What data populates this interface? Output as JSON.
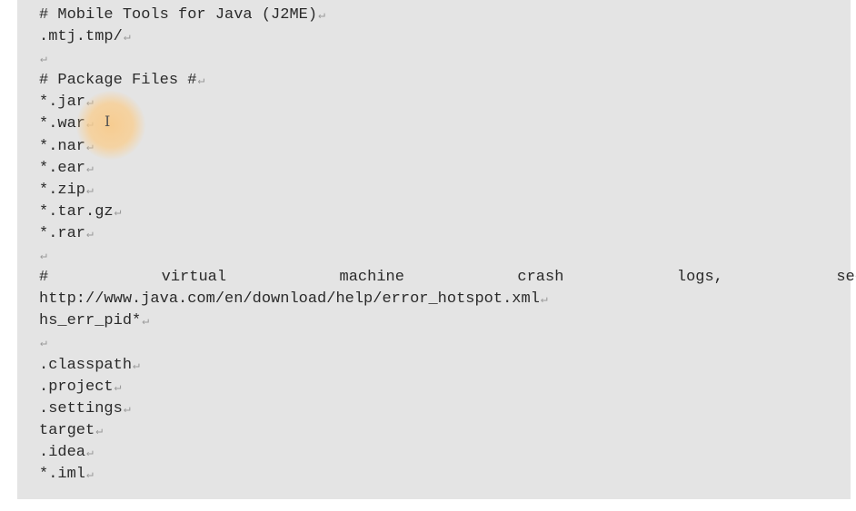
{
  "document": {
    "lines": [
      {
        "text": "# Mobile Tools for Java (J2ME)",
        "mark": "↵"
      },
      {
        "text": ".mtj.tmp/",
        "mark": "↵"
      },
      {
        "text": "",
        "mark": "↵"
      },
      {
        "text": "# Package Files #",
        "mark": "↵"
      },
      {
        "text": "*.jar",
        "mark": "↵"
      },
      {
        "text": "*.war",
        "mark": "↵"
      },
      {
        "text": "*.nar",
        "mark": "↵"
      },
      {
        "text": "*.ear",
        "mark": "↵"
      },
      {
        "text": "*.zip",
        "mark": "↵"
      },
      {
        "text": "*.tar.gz",
        "mark": "↵"
      },
      {
        "text": "*.rar",
        "mark": "↵"
      },
      {
        "text": "",
        "mark": "↵"
      },
      {
        "words": [
          "#",
          "virtual",
          "machine",
          "crash",
          "logs,",
          "see"
        ]
      },
      {
        "text": "http://www.java.com/en/download/help/error_hotspot.xml",
        "mark": "↵"
      },
      {
        "text": "hs_err_pid*",
        "mark": "↵"
      },
      {
        "text": "",
        "mark": "↵"
      },
      {
        "text": ".classpath",
        "mark": "↵"
      },
      {
        "text": ".project",
        "mark": "↵"
      },
      {
        "text": ".settings",
        "mark": "↵"
      },
      {
        "text": "target",
        "mark": "↵"
      },
      {
        "text": ".idea",
        "mark": "↵"
      },
      {
        "text": "*.iml",
        "mark": "↵"
      }
    ],
    "cursor_glyph": "I"
  },
  "colors": {
    "block_background": "#e4e4e4",
    "text": "#2a2a2a",
    "paragraph_mark": "#9a9a9a",
    "cursor_highlight": "#f7c98a"
  }
}
